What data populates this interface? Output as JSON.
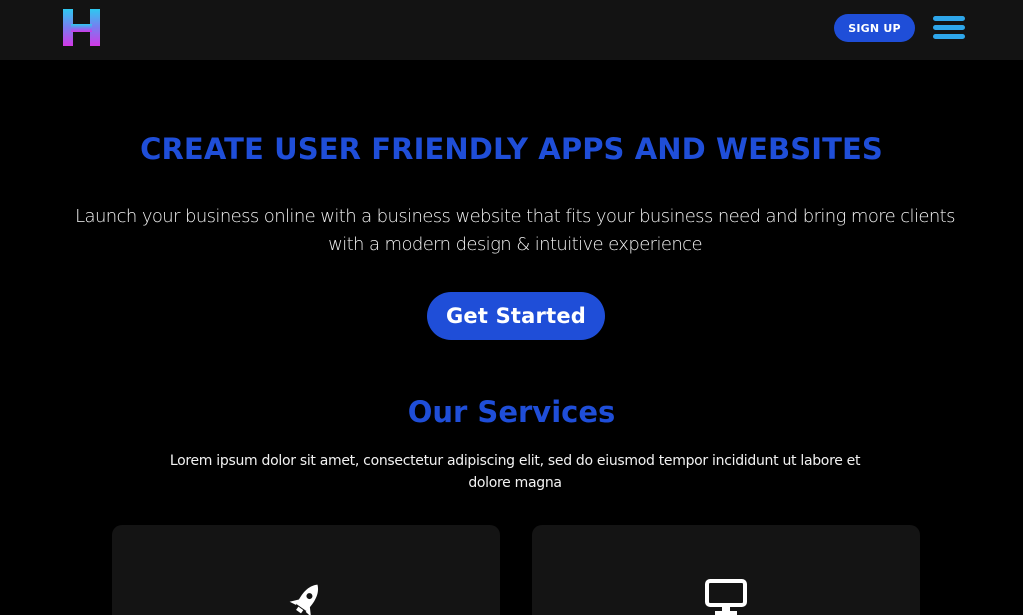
{
  "header": {
    "logo_icon": "h-logo-icon",
    "signup_label": "SIGN UP",
    "menu_icon": "hamburger-menu-icon"
  },
  "hero": {
    "title": "CREATE USER FRIENDLY APPS AND WEBSITES",
    "description": "Launch your business online with a business website that fits your business need and bring more clients with a modern design & intuitive experience",
    "cta_label": "Get Started"
  },
  "services": {
    "title": "Our Services",
    "description": "Lorem ipsum dolor sit amet, consectetur adipiscing elit, sed do eiusmod tempor incididunt ut labore et dolore magna",
    "cards": [
      {
        "icon": "rocket-icon"
      },
      {
        "icon": "desktop-monitor-icon"
      }
    ]
  },
  "colors": {
    "accent": "#1f4ed8",
    "menu": "#2ea6ea",
    "navbar": "#131313",
    "card": "#141414",
    "background": "#000000",
    "logo_gradient": [
      "#c238e8",
      "#2ec9f0"
    ]
  }
}
